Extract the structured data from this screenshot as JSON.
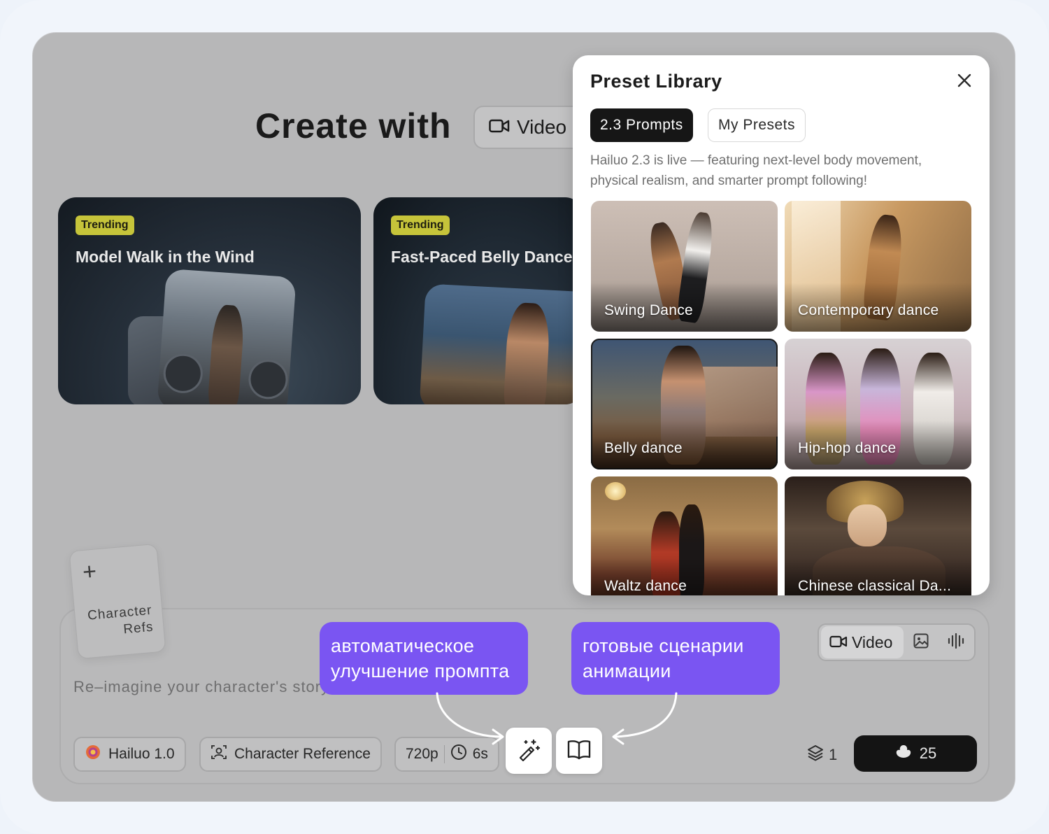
{
  "header": {
    "title": "Create with",
    "mode_label": "Video"
  },
  "trending_cards": [
    {
      "badge": "Trending",
      "title": "Model Walk in the Wind"
    },
    {
      "badge": "Trending",
      "title": "Fast-Paced Belly Dance"
    }
  ],
  "character_refs": {
    "plus": "+",
    "label_line1": "Character",
    "label_line2": "Refs"
  },
  "prompt": {
    "placeholder": "Re–imagine your character's story..."
  },
  "mode_switch": {
    "video_label": "Video"
  },
  "chips": {
    "model": "Hailuo 1.0",
    "character_reference": "Character Reference",
    "resolution": "720p",
    "duration": "6s"
  },
  "count": "1",
  "generate": {
    "credits": "25"
  },
  "annotations": {
    "left_line1": "автоматическое",
    "left_line2": "улучшение промпта",
    "right_line1": "готовые сценарии",
    "right_line2": "анимации"
  },
  "preset_library": {
    "title": "Preset Library",
    "tabs": [
      "2.3 Prompts",
      "My Presets"
    ],
    "description": "Hailuo 2.3 is live — featuring next-level body movement, physical realism, and smarter prompt following!",
    "items": [
      {
        "label": "Swing Dance"
      },
      {
        "label": "Contemporary dance"
      },
      {
        "label": "Belly dance"
      },
      {
        "label": "Hip-hop dance"
      },
      {
        "label": "Waltz dance"
      },
      {
        "label": "Chinese classical Da..."
      }
    ]
  },
  "colors": {
    "accent_callout": "#7a55f2",
    "trending_badge": "#c6c43a",
    "generate_button": "#141414"
  },
  "icons": [
    "video-camera-icon",
    "image-icon",
    "audio-wave-icon",
    "magic-wand-icon",
    "book-icon",
    "layers-icon",
    "credit-icon",
    "clock-icon",
    "character-icon",
    "close-icon",
    "plus-icon",
    "hailuo-logo-icon"
  ]
}
